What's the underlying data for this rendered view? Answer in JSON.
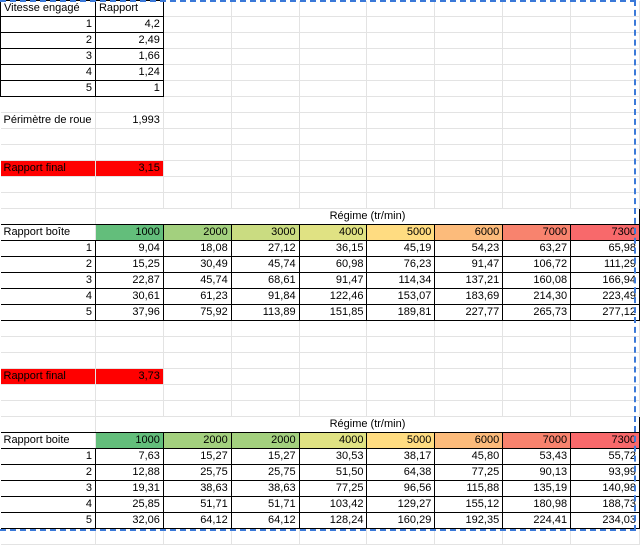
{
  "gear_table": {
    "header_gear": "Vitesse engagé",
    "header_ratio": "Rapport",
    "rows": [
      {
        "gear": "1",
        "ratio": "4,2"
      },
      {
        "gear": "2",
        "ratio": "2,49"
      },
      {
        "gear": "3",
        "ratio": "1,66"
      },
      {
        "gear": "4",
        "ratio": "1,24"
      },
      {
        "gear": "5",
        "ratio": "1"
      }
    ]
  },
  "wheel": {
    "label": "Périmètre de roue",
    "value": "1,993"
  },
  "block1": {
    "final_label": "Rapport final",
    "final_value": "3,15",
    "regime_title": "Régime (tr/min)",
    "row_label": "Rapport boîte",
    "rpm": [
      "1000",
      "2000",
      "3000",
      "4000",
      "5000",
      "6000",
      "7000",
      "7300"
    ],
    "rpm_colors": [
      "#63be7b",
      "#a3d07e",
      "#cadc81",
      "#e0e283",
      "#ffdc81",
      "#fcbb7b",
      "#f8836e",
      "#f8696b"
    ],
    "rows": [
      {
        "gear": "1",
        "speeds": [
          "9,04",
          "18,08",
          "27,12",
          "36,15",
          "45,19",
          "54,23",
          "63,27",
          "65,98"
        ]
      },
      {
        "gear": "2",
        "speeds": [
          "15,25",
          "30,49",
          "45,74",
          "60,98",
          "76,23",
          "91,47",
          "106,72",
          "111,29"
        ]
      },
      {
        "gear": "3",
        "speeds": [
          "22,87",
          "45,74",
          "68,61",
          "91,47",
          "114,34",
          "137,21",
          "160,08",
          "166,94"
        ]
      },
      {
        "gear": "4",
        "speeds": [
          "30,61",
          "61,23",
          "91,84",
          "122,46",
          "153,07",
          "183,69",
          "214,30",
          "223,49"
        ]
      },
      {
        "gear": "5",
        "speeds": [
          "37,96",
          "75,92",
          "113,89",
          "151,85",
          "189,81",
          "227,77",
          "265,73",
          "277,12"
        ]
      }
    ]
  },
  "block2": {
    "final_label": "Rapport final",
    "final_value": "3,73",
    "regime_title": "Régime (tr/min)",
    "row_label": "Rapport boite",
    "rpm": [
      "1000",
      "2000",
      "2000",
      "4000",
      "5000",
      "6000",
      "7000",
      "7300"
    ],
    "rpm_colors": [
      "#63be7b",
      "#a3d07e",
      "#a3d07e",
      "#e0e283",
      "#ffdc81",
      "#fcbb7b",
      "#f8836e",
      "#f8696b"
    ],
    "rows": [
      {
        "gear": "1",
        "speeds": [
          "7,63",
          "15,27",
          "15,27",
          "30,53",
          "38,17",
          "45,80",
          "53,43",
          "55,72"
        ]
      },
      {
        "gear": "2",
        "speeds": [
          "12,88",
          "25,75",
          "25,75",
          "51,50",
          "64,38",
          "77,25",
          "90,13",
          "93,99"
        ]
      },
      {
        "gear": "3",
        "speeds": [
          "19,31",
          "38,63",
          "38,63",
          "77,25",
          "96,56",
          "115,88",
          "135,19",
          "140,98"
        ]
      },
      {
        "gear": "4",
        "speeds": [
          "25,85",
          "51,71",
          "51,71",
          "103,42",
          "129,27",
          "155,12",
          "180,98",
          "188,73"
        ]
      },
      {
        "gear": "5",
        "speeds": [
          "32,06",
          "64,12",
          "64,12",
          "128,24",
          "160,29",
          "192,35",
          "224,41",
          "234,03"
        ]
      }
    ]
  }
}
